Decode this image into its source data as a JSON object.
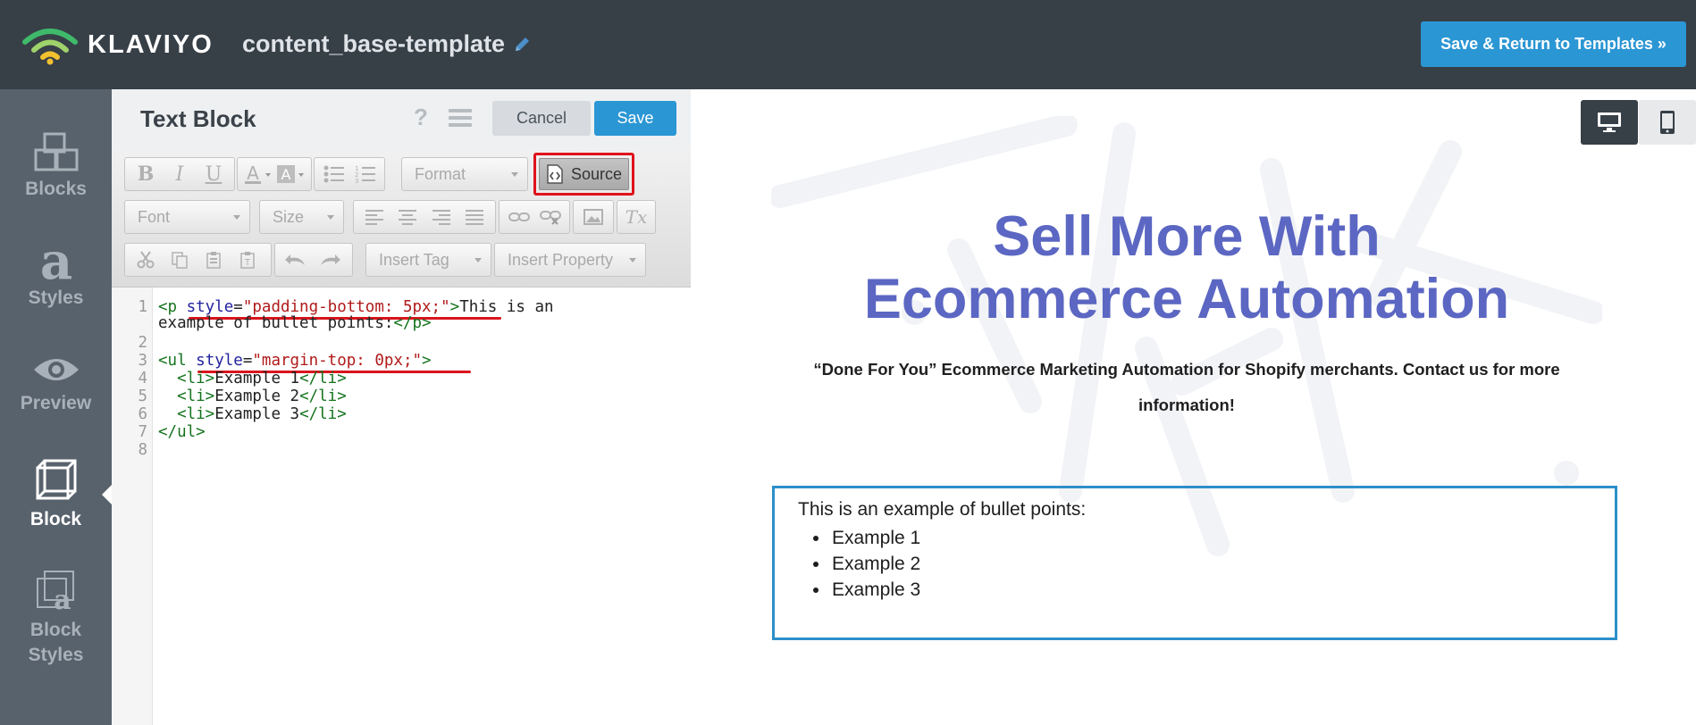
{
  "header": {
    "logo_text": "KLAVIYO",
    "template_name": "content_base-template",
    "save_return_label": "Save & Return to Templates »",
    "accent_color": "#2b96d4"
  },
  "rail": {
    "items": [
      {
        "label": "Blocks",
        "icon": "blocks-icon",
        "active": false
      },
      {
        "label": "Styles",
        "icon": "styles-icon",
        "active": false
      },
      {
        "label": "Preview",
        "icon": "eye-icon",
        "active": false
      },
      {
        "label": "Block",
        "icon": "cube-icon",
        "active": true
      },
      {
        "label": "Block Styles",
        "icon": "block-styles-icon",
        "active": false
      }
    ]
  },
  "editor": {
    "title": "Text Block",
    "help_label": "?",
    "cancel_label": "Cancel",
    "save_label": "Save",
    "toolbar": {
      "format_label": "Format",
      "source_label": "Source",
      "font_label": "Font",
      "size_label": "Size",
      "insert_tag_label": "Insert Tag",
      "insert_property_label": "Insert Property",
      "bold": "B",
      "italic": "I",
      "underline": "U",
      "clear_format": "Tx"
    },
    "code_lines": [
      "1",
      "2",
      "3",
      "4",
      "5",
      "6",
      "7",
      "8"
    ],
    "code": {
      "l1_open": "<p ",
      "l1_attr": "style",
      "l1_eq": "=",
      "l1_val": "\"padding-bottom: 5px;\"",
      "l1_close": ">",
      "l1_text": "This is an",
      "l1b_text": "example of bullet points:",
      "l1b_end": "</p>",
      "l3_open": "<ul ",
      "l3_attr": "style",
      "l3_eq": "=",
      "l3_val": "\"margin-top: 0px;\"",
      "l3_close": ">",
      "li_open": "<li>",
      "li_close": "</li>",
      "ul_end": "</ul>",
      "items": [
        "Example 1",
        "Example 2",
        "Example 3"
      ]
    }
  },
  "preview": {
    "hero_line1": "Sell More With",
    "hero_line2": "Ecommerce Automation",
    "subtitle": "“Done For You” Ecommerce Marketing Automation for Shopify merchants. Contact us for more information!",
    "block_paragraph": "This is an example of bullet points:",
    "block_items": [
      "Example 1",
      "Example 2",
      "Example 3"
    ],
    "hero_color": "#5b67c2"
  }
}
